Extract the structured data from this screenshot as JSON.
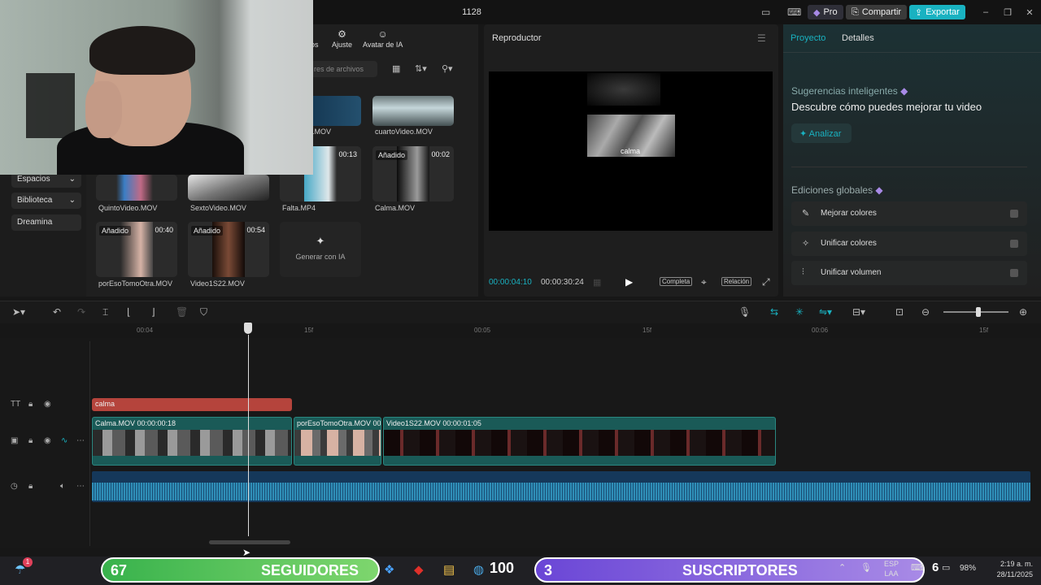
{
  "window": {
    "title": "1128",
    "pro_label": "Pro",
    "share_label": "Compartir",
    "export_label": "Exportar"
  },
  "media": {
    "tabs": [
      {
        "label": "os"
      },
      {
        "label": "Ajuste"
      },
      {
        "label": "Avatar de IA"
      }
    ],
    "search_placeholder": "res de archivos",
    "sidebar": [
      {
        "label": "Espacios"
      },
      {
        "label": "Biblioteca"
      },
      {
        "label": "Dreamina"
      }
    ],
    "items": [
      {
        "name": "eo.MOV",
        "badge": "",
        "duration": ""
      },
      {
        "name": "cuartoVideo.MOV",
        "badge": "",
        "duration": ""
      },
      {
        "name": "QuintoVideo.MOV",
        "badge": "",
        "duration": ""
      },
      {
        "name": "SextoVideo.MOV",
        "badge": "",
        "duration": ""
      },
      {
        "name": "Falta.MP4",
        "badge": "",
        "duration": "00:13"
      },
      {
        "name": "Calma.MOV",
        "badge": "Añadido",
        "duration": "00:02"
      },
      {
        "name": "porEsoTomoOtra.MOV",
        "badge": "Añadido",
        "duration": "00:40"
      },
      {
        "name": "Video1S22.MOV",
        "badge": "Añadido",
        "duration": "00:54"
      }
    ],
    "generate_label": "Generar con IA"
  },
  "player": {
    "title": "Reproductor",
    "caption": "calma",
    "current_time": "00:00:04:10",
    "total_time": "00:00:30:24",
    "full_label": "Completa",
    "ratio_label": "Relación"
  },
  "right_panel": {
    "tabs": [
      "Proyecto",
      "Detalles"
    ],
    "suggestions_title": "Sugerencias inteligentes",
    "suggestions_heading": "Descubre cómo puedes mejorar tu video",
    "analyze_label": "Analizar",
    "global_title": "Ediciones globales",
    "global_items": [
      "Mejorar colores",
      "Unificar colores",
      "Unificar volumen"
    ]
  },
  "timeline": {
    "ticks": [
      "00:04",
      "15f",
      "00:05",
      "15f",
      "00:06",
      "15f"
    ],
    "text_clip": "calma",
    "video_clips": [
      {
        "label": "Calma.MOV   00:00:00:18"
      },
      {
        "label": "porEsoTomoOtra.MOV   00:"
      },
      {
        "label": "Video1S22.MOV   00:00:01:05"
      }
    ]
  },
  "taskbar": {
    "followers_count": "67",
    "followers_label": "SEGUIDORES",
    "count_100": "100",
    "subs_count": "3",
    "subs_label": "SUSCRIPTORES",
    "lang_top": "ESP",
    "lang_bottom": "LAA",
    "battery_num": "6",
    "battery": "98%",
    "time": "2:19 a. m.",
    "date": "28/11/2025",
    "notif": "1"
  },
  "colors": {
    "accent": "#19b2c1",
    "text_clip": "#b5443c",
    "video_clip": "#1a5a57",
    "audio": "#15385a"
  }
}
